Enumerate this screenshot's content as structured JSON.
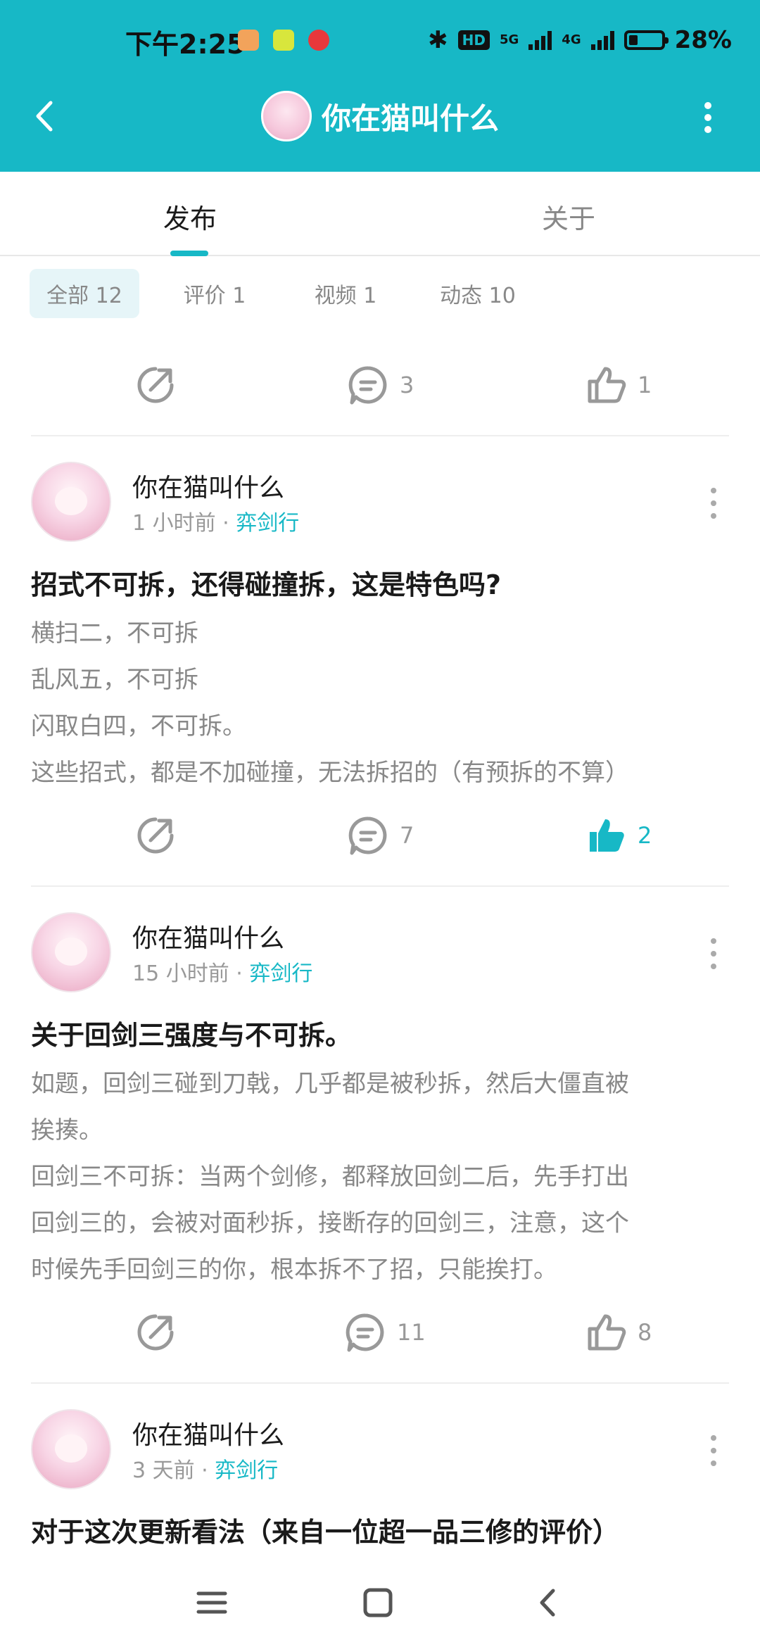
{
  "status": {
    "time": "下午2:25",
    "hd": "HD",
    "net1": "5G",
    "net2": "4G",
    "battery": "28%",
    "battery_level": 0.28
  },
  "header": {
    "title": "你在猫叫什么"
  },
  "tabs": [
    "发布",
    "关于"
  ],
  "filters": [
    "全部 12",
    "评价 1",
    "视频 1",
    "动态 10"
  ],
  "top_actions": {
    "comments": "3",
    "likes": "1"
  },
  "posts": [
    {
      "user": "你在猫叫什么",
      "time": "1 小时前",
      "dot": "·",
      "tag": "弈剑行",
      "title": "招式不可拆，还得碰撞拆，这是特色吗?",
      "lines": [
        "横扫二，不可拆",
        "乱风五，不可拆",
        "闪取白四，不可拆。",
        "这些招式，都是不加碰撞，无法拆招的（有预拆的不算）"
      ],
      "comments": "7",
      "likes": "2",
      "liked": true
    },
    {
      "user": "你在猫叫什么",
      "time": "15 小时前",
      "dot": "·",
      "tag": "弈剑行",
      "title": "关于回剑三强度与不可拆。",
      "lines": [
        "如题，回剑三碰到刀戟，几乎都是被秒拆，然后大僵直被",
        "挨揍。",
        "回剑三不可拆：当两个剑修，都释放回剑二后，先手打出",
        "回剑三的，会被对面秒拆，接断存的回剑三，注意，这个",
        "时候先手回剑三的你，根本拆不了招，只能挨打。"
      ],
      "comments": "11",
      "likes": "8",
      "liked": false
    },
    {
      "user": "你在猫叫什么",
      "time": "3 天前",
      "dot": "·",
      "tag": "弈剑行",
      "title": "对于这次更新看法（来自一位超一品三修的评价）"
    }
  ],
  "colors": {
    "accent": "#17b8c6",
    "text_muted": "#999999"
  }
}
